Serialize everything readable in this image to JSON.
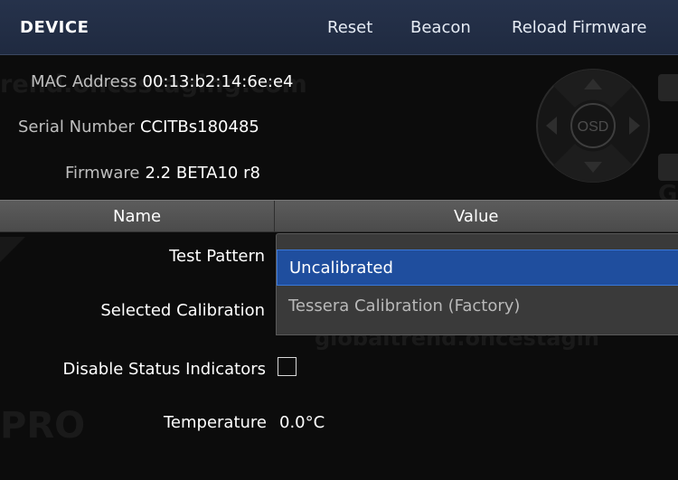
{
  "header": {
    "title": "DEVICE",
    "actions": {
      "reset": "Reset",
      "beacon": "Beacon",
      "reload_firmware": "Reload Firmware"
    }
  },
  "device_info": {
    "mac": {
      "label": "MAC Address",
      "value": "00:13:b2:14:6e:e4"
    },
    "serial": {
      "label": "Serial Number",
      "value": "CCITBs180485"
    },
    "firmware": {
      "label": "Firmware",
      "value": "2.2 BETA10 r8"
    }
  },
  "osd": {
    "label": "OSD"
  },
  "table": {
    "columns": {
      "name": "Name",
      "value": "Value"
    },
    "rows": {
      "test_pattern": {
        "label": "Test Pattern"
      },
      "selected_calibration": {
        "label": "Selected Calibration"
      },
      "disable_status_indicators": {
        "label": "Disable Status Indicators",
        "checked": false
      },
      "temperature": {
        "label": "Temperature",
        "value": "0.0°C"
      }
    }
  },
  "dropdown": {
    "options": [
      "Uncalibrated",
      "Tessera Calibration (Factory)"
    ],
    "highlighted": "Uncalibrated"
  },
  "watermarks": [
    "rend.oncestaging.com",
    "globaltrend.oncestagin",
    "PRO",
    "GL"
  ],
  "colors": {
    "header_bg": "#26324b",
    "highlight": "#1f4e9e",
    "table_header_bg": "#555555",
    "background": "#0c0c0c"
  }
}
